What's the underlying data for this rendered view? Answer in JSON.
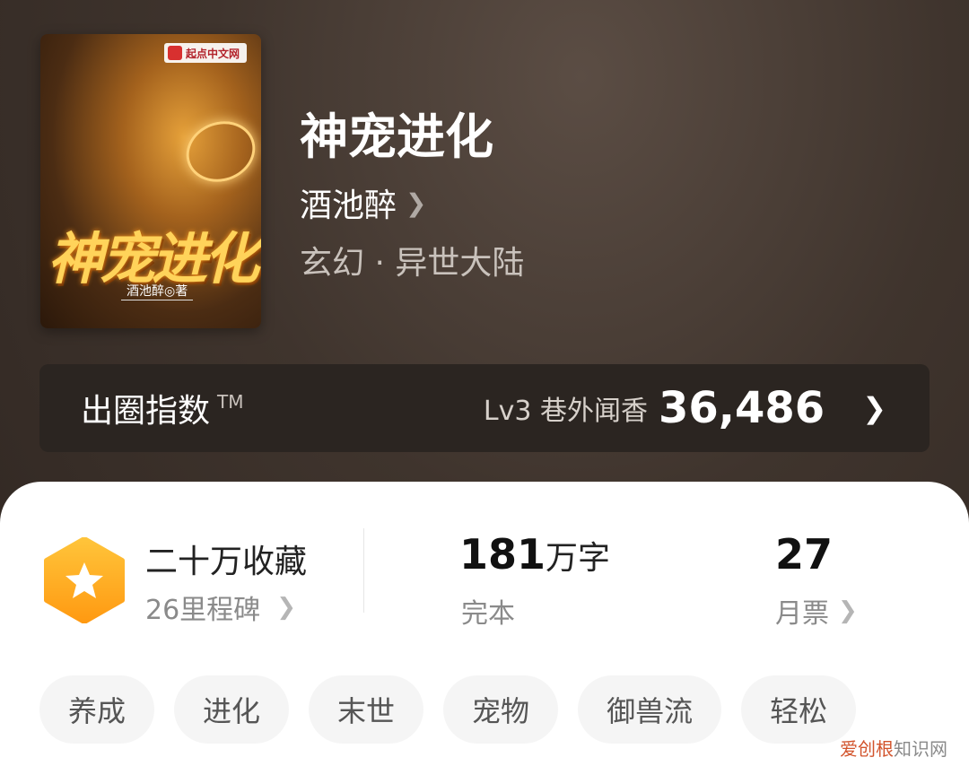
{
  "cover": {
    "publisher": "起点中文网",
    "art_title": "神宠进化",
    "art_author": "酒池醉◎著"
  },
  "book": {
    "title": "神宠进化",
    "author": "酒池醉",
    "genre": "玄幻 · 异世大陆"
  },
  "banner": {
    "title": "出圈指数",
    "tm": "TM",
    "level": "Lv3 巷外闻香",
    "score": "36,486"
  },
  "stats": {
    "collect_title": "二十万收藏",
    "collect_sub": "26里程碑",
    "words_num": "181",
    "words_unit": "万字",
    "words_status": "完本",
    "tickets_num": "27",
    "tickets_label": "月票"
  },
  "tags": [
    "养成",
    "进化",
    "末世",
    "宠物",
    "御兽流",
    "轻松"
  ],
  "watermark": {
    "brand": "爱创根",
    "suffix": "知识网"
  },
  "colors": {
    "badge_top": "#ffc43a",
    "badge_bottom": "#ff9a12",
    "header_bg": "#3f342d"
  }
}
